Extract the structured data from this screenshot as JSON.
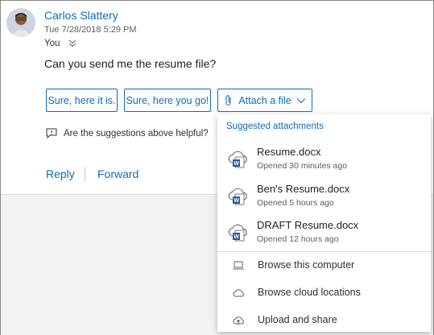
{
  "message": {
    "sender": "Carlos Slattery",
    "date": "Tue 7/28/2018 5:29 PM",
    "to": "You",
    "body": "Can you send me the resume file?"
  },
  "suggestions": [
    "Sure, here it is.",
    "Sure, here you go!"
  ],
  "attach_label": "Attach a file",
  "feedback_prompt": "Are the suggestions above helpful?",
  "actions": {
    "reply": "Reply",
    "forward": "Forward"
  },
  "attachments": {
    "header": "Suggested attachments",
    "files": [
      {
        "name": "Resume.docx",
        "meta": "Opened 30 minutes ago"
      },
      {
        "name": "Ben's Resume.docx",
        "meta": "Opened 5 hours ago"
      },
      {
        "name": "DRAFT Resume.docx",
        "meta": "Opened 12 hours ago"
      }
    ],
    "options": [
      {
        "label": "Browse this computer",
        "icon": "laptop-icon"
      },
      {
        "label": "Browse cloud locations",
        "icon": "cloud-icon"
      },
      {
        "label": "Upload and share",
        "icon": "cloud-upload-icon"
      }
    ]
  },
  "colors": {
    "accent": "#0f6cbd",
    "word": "#2b579a"
  }
}
